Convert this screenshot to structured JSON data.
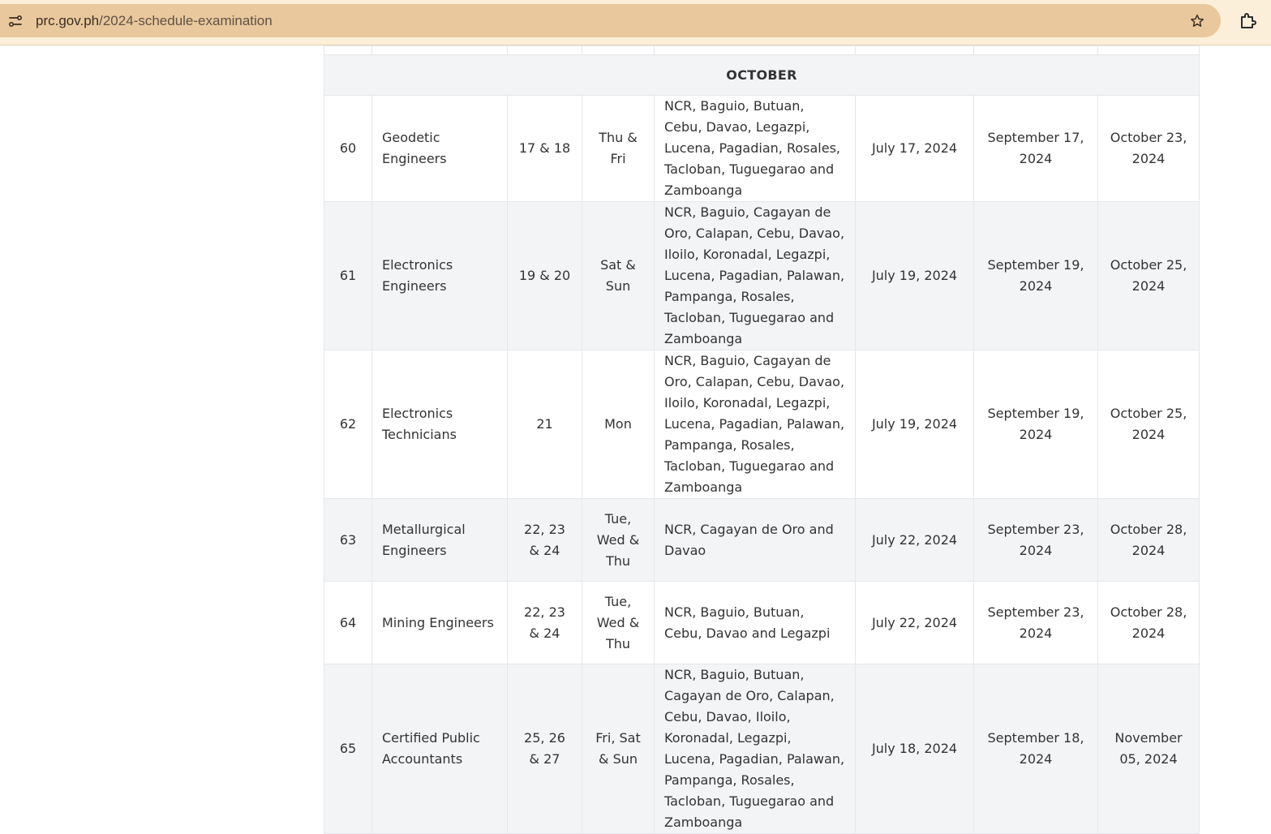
{
  "browser": {
    "url_domain": "prc.gov.ph",
    "url_path": "/2024-schedule-examination",
    "site_info_icon": "tune-icon",
    "bookmark_icon": "star-icon",
    "extensions_icon": "puzzle-icon"
  },
  "table": {
    "month": "OCTOBER",
    "rows": [
      {
        "no": "60",
        "profession": "Geodetic Engineers",
        "dates": "17 & 18",
        "days": "Thu & Fri",
        "venues": "NCR, Baguio, Butuan, Cebu, Davao, Legazpi, Lucena, Pagadian, Rosales, Tacloban, Tuguegarao and Zamboanga",
        "deadline": "July 17, 2024",
        "deadline2": "September 17, 2024",
        "release": "October 23, 2024"
      },
      {
        "no": "61",
        "profession": "Electronics Engineers",
        "dates": "19 & 20",
        "days": "Sat & Sun",
        "venues": "NCR, Baguio, Cagayan de Oro, Calapan, Cebu, Davao, Iloilo, Koronadal, Legazpi, Lucena, Pagadian, Palawan, Pampanga, Rosales, Tacloban, Tuguegarao and Zamboanga",
        "deadline": "July 19, 2024",
        "deadline2": "September 19, 2024",
        "release": "October 25, 2024"
      },
      {
        "no": "62",
        "profession": "Electronics Technicians",
        "dates": "21",
        "days": "Mon",
        "venues": "NCR, Baguio, Cagayan de Oro, Calapan, Cebu, Davao, Iloilo, Koronadal, Legazpi, Lucena, Pagadian, Palawan, Pampanga, Rosales, Tacloban, Tuguegarao and Zamboanga",
        "deadline": "July 19, 2024",
        "deadline2": "September 19, 2024",
        "release": "October 25, 2024"
      },
      {
        "no": "63",
        "profession": "Metallurgical Engineers",
        "dates": "22, 23 & 24",
        "days": "Tue, Wed & Thu",
        "venues": "NCR, Cagayan de Oro and Davao",
        "deadline": "July 22, 2024",
        "deadline2": "September 23, 2024",
        "release": "October 28, 2024"
      },
      {
        "no": "64",
        "profession": "Mining Engineers",
        "dates": "22, 23 & 24",
        "days": "Tue, Wed & Thu",
        "venues": "NCR, Baguio, Butuan, Cebu, Davao and Legazpi",
        "deadline": "July 22, 2024",
        "deadline2": "September 23, 2024",
        "release": "October 28, 2024"
      },
      {
        "no": "65",
        "profession": "Certified Public Accountants",
        "dates": "25, 26 & 27",
        "days": "Fri, Sat & Sun",
        "venues": "NCR, Baguio, Butuan, Cagayan de Oro, Calapan, Cebu, Davao, Iloilo, Koronadal, Legazpi, Lucena, Pagadian, Palawan, Pampanga, Rosales, Tacloban, Tuguegarao and Zamboanga",
        "deadline": "July 18, 2024",
        "deadline2": "September 18, 2024",
        "release": "November 05, 2024"
      }
    ]
  }
}
